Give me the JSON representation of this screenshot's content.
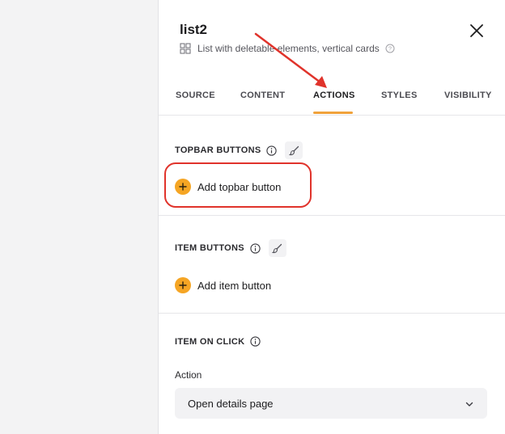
{
  "panel": {
    "title": "list2",
    "subtitle": "List with deletable elements, vertical cards"
  },
  "tabs": [
    {
      "label": "SOURCE",
      "active": false
    },
    {
      "label": "CONTENT",
      "active": false
    },
    {
      "label": "ACTIONS",
      "active": true
    },
    {
      "label": "STYLES",
      "active": false
    },
    {
      "label": "VISIBILITY",
      "active": false
    }
  ],
  "sections": {
    "topbar": {
      "title": "TOPBAR BUTTONS",
      "add_label": "Add topbar button"
    },
    "item_buttons": {
      "title": "ITEM BUTTONS",
      "add_label": "Add item button"
    },
    "item_on_click": {
      "title": "ITEM ON CLICK",
      "field_label": "Action",
      "select_value": "Open details page"
    }
  },
  "colors": {
    "accent": "#f5a524",
    "annotation": "#e0332b",
    "tab_underline": "#f0a23b"
  },
  "icons": [
    "close-icon",
    "grid-icon",
    "help-icon",
    "info-icon",
    "brush-icon",
    "plus-icon",
    "chevron-down-icon"
  ]
}
